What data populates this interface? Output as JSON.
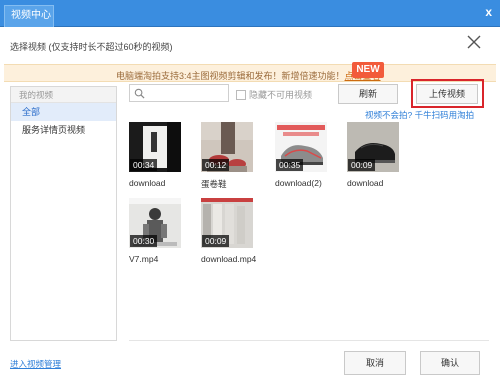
{
  "window": {
    "tab_title": "视频中心",
    "close_label": "x"
  },
  "header": {
    "title": "选择视频 (仅支持时长不超过60秒的视频)"
  },
  "notice": {
    "text": "电脑端淘拍支持3:4主图视频剪辑和发布！新增倍速功能！",
    "link": "点击查看",
    "badge": "NEW"
  },
  "sidebar": {
    "header": "我的视频",
    "items": [
      {
        "label": "全部",
        "active": true
      },
      {
        "label": "服务详情页视频",
        "active": false
      }
    ]
  },
  "toolbar": {
    "search_placeholder": "",
    "hide_unavailable_label": "隐藏不可用视频",
    "refresh_label": "刷新",
    "upload_label": "上传视频"
  },
  "links": {
    "cannot_upload": "视频不会拍?",
    "scan": "千牛扫码用淘拍"
  },
  "videos": [
    {
      "name": "download",
      "duration": "00:34"
    },
    {
      "name": "蛋卷鞋",
      "duration": "00:12"
    },
    {
      "name": "download(2)",
      "duration": "00:35"
    },
    {
      "name": "download",
      "duration": "00:09"
    },
    {
      "name": "V7.mp4",
      "duration": "00:30"
    },
    {
      "name": "download.mp4",
      "duration": "00:09"
    }
  ],
  "footer": {
    "manage_link": "进入视频管理",
    "cancel_label": "取消",
    "ok_label": "确认"
  },
  "colors": {
    "titlebar": "#3a8de0",
    "accent": "#2f7fd8",
    "highlight_outline": "#d9252b",
    "notice_bg": "#fdf0dc"
  }
}
